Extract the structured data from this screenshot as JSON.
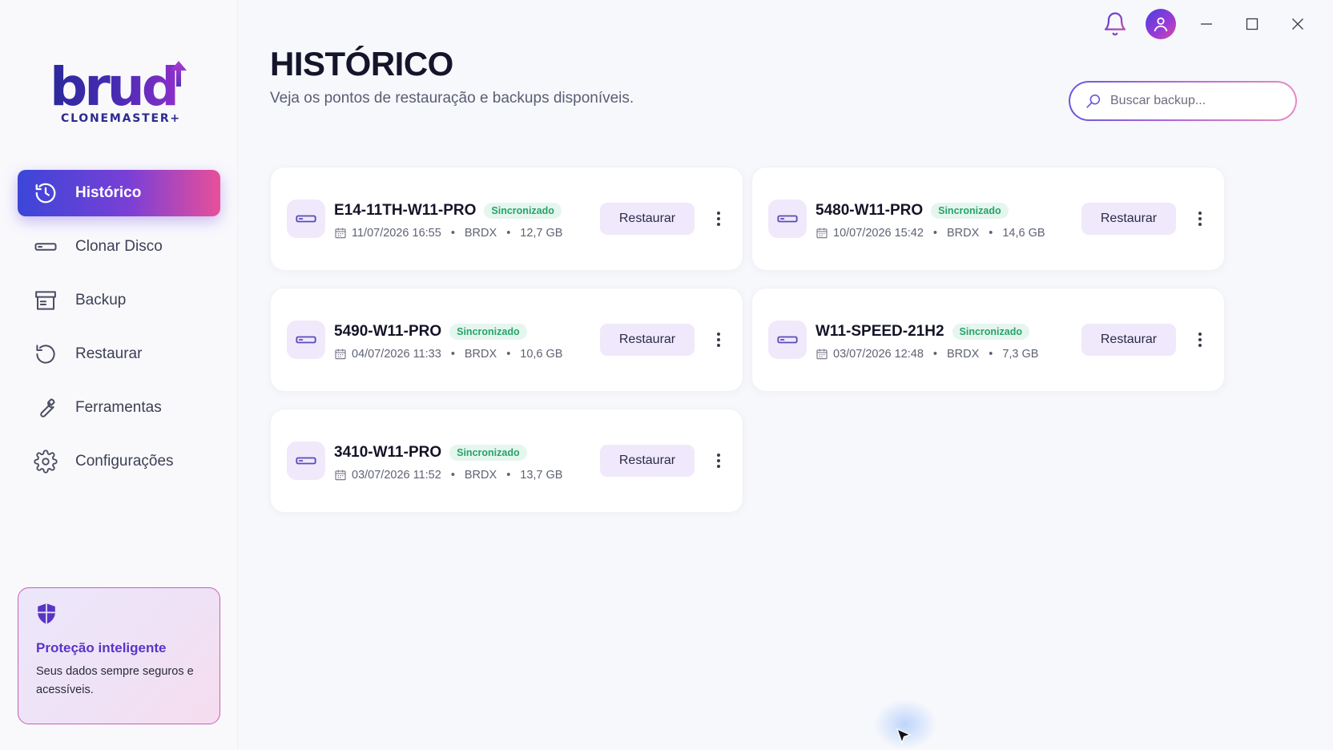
{
  "app": {
    "logo_word": "brud",
    "logo_sub": "CLONEMASTER+"
  },
  "sidebar": {
    "items": [
      {
        "label": "Histórico",
        "icon": "history-icon",
        "active": true
      },
      {
        "label": "Clonar Disco",
        "icon": "drive-icon",
        "active": false
      },
      {
        "label": "Backup",
        "icon": "archive-icon",
        "active": false
      },
      {
        "label": "Restaurar",
        "icon": "restore-icon",
        "active": false
      },
      {
        "label": "Ferramentas",
        "icon": "wrench-icon",
        "active": false
      },
      {
        "label": "Configurações",
        "icon": "gear-icon",
        "active": false
      }
    ],
    "promo": {
      "icon": "shield-icon",
      "title": "Proteção inteligente",
      "text": "Seus dados sempre seguros e acessíveis."
    }
  },
  "header": {
    "title": "HISTÓRICO",
    "subtitle": "Veja os pontos de restauração e backups disponíveis.",
    "search_placeholder": "Buscar backup..."
  },
  "cards": [
    {
      "name": "E14-11TH-W11-PRO",
      "status": "Sincronizado",
      "date": "11/07/2026 16:55",
      "source": "BRDX",
      "size": "12,7 GB",
      "action": "Restaurar"
    },
    {
      "name": "5480-W11-PRO",
      "status": "Sincronizado",
      "date": "10/07/2026 15:42",
      "source": "BRDX",
      "size": "14,6 GB",
      "action": "Restaurar"
    },
    {
      "name": "5490-W11-PRO",
      "status": "Sincronizado",
      "date": "04/07/2026 11:33",
      "source": "BRDX",
      "size": "10,6 GB",
      "action": "Restaurar"
    },
    {
      "name": "W11-SPEED-21H2",
      "status": "Sincronizado",
      "date": "03/07/2026 12:48",
      "source": "BRDX",
      "size": "7,3 GB",
      "action": "Restaurar"
    },
    {
      "name": "3410-W11-PRO",
      "status": "Sincronizado",
      "date": "03/07/2026 11:52",
      "source": "BRDX",
      "size": "13,7 GB",
      "action": "Restaurar"
    }
  ],
  "meta_separator": "•",
  "colors": {
    "accent_start": "#3b46d8",
    "accent_end": "#e84f9a",
    "brand": "#4a2bb5",
    "status_green": "#27a36a",
    "button_bg": "#efe9fb"
  }
}
